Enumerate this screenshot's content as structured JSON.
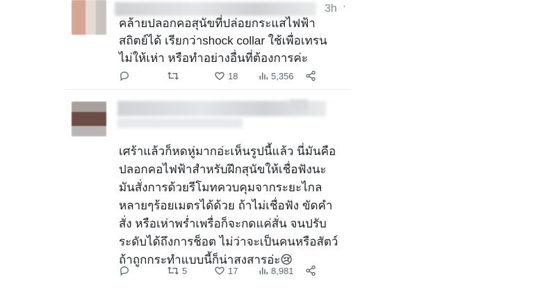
{
  "tweets": [
    {
      "time": "3h",
      "text": "คล้ายปลอกคอสุนัขที่ปล่อยกระแสไฟฟ้า\nสถิตย์ได้ เรียกว่าshock collar ใช้เพื่อเทรน\nไม่ให้เห่า หรือทำอย่างอื่นที่ต้องการค่ะ",
      "actions": {
        "reply_count": "",
        "retweet_count": "",
        "like_count": "18",
        "view_count": "5,356"
      }
    },
    {
      "text": "เศร้าแล้วก็หดหู่มากอ่ะเห็นรูปนี้แล้ว นี่มันคือ\nปลอกคอไฟฟ้าสำหรับฝึกสุนัขให้เชื่อฟังนะ\nมันสั่งการด้วยรีโมทควบคุมจากระยะไกล\nหลายๆร้อยเมตรได้ด้วย ถ้าไม่เชื่อฟัง ขัดคำ\nสั่ง หรือเห่าพร่ำเพรื่อก็จะกดแค่สั่น จนปรับ\nระดับได้ถึงการช็อต ไม่ว่าจะเป็นคนหรือสัตว์\nถ้าถูกกระทำแบบนี้ก็น่าสงสารอ่ะ😢",
      "actions": {
        "reply_count": "",
        "retweet_count": "5",
        "like_count": "17",
        "view_count": "8,981"
      }
    }
  ],
  "icons": {
    "reply": "reply-icon",
    "retweet": "retweet-icon",
    "like": "heart-icon",
    "views": "views-icon",
    "share": "share-icon"
  },
  "colors": {
    "text": "#1a1f24",
    "muted": "#586773",
    "divider": "#e6ecf0"
  }
}
